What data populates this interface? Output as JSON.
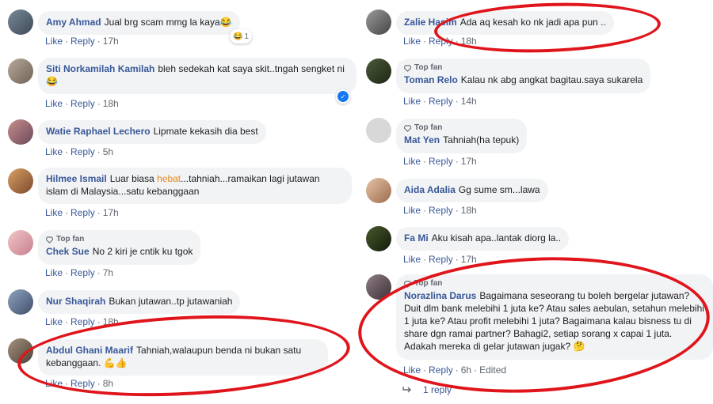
{
  "actions": {
    "like": "Like",
    "reply": "Reply",
    "sep": "·",
    "edited": "Edited"
  },
  "top_fan_label": "Top fan",
  "left": [
    {
      "name": "Amy Ahmad",
      "text": "Jual brg scam mmg la kaya",
      "emoji": "😂",
      "time": "17h",
      "reaction": {
        "icon": "😂",
        "count": "1"
      }
    },
    {
      "name": "Siti Norkamilah Kamilah",
      "text": "bleh sedekah kat saya skit..tngah sengket ni",
      "emoji": "😂",
      "time": "18h",
      "reaction": {
        "icon": "👍",
        "count": ""
      }
    },
    {
      "name": "Watie Raphael Lechero",
      "text": "Lipmate kekasih dia best",
      "time": "5h"
    },
    {
      "name": "Hilmee Ismail",
      "text_before": "Luar biasa ",
      "text_highlight": "hebat",
      "text_after": "...tahniah...ramaikan lagi jutawan islam di Malaysia...satu kebanggaan",
      "time": "17h"
    },
    {
      "name": "Chek Sue",
      "text": "No 2 kiri je cntik ku tgok",
      "time": "7h",
      "top_fan": true
    },
    {
      "name": "Nur Shaqirah",
      "text": "Bukan jutawan..tp jutawaniah",
      "time": "18h"
    },
    {
      "name": "Abdul Ghani Maarif",
      "text": "Tahniah,walaupun benda ni bukan satu kebanggaan.",
      "emoji": "💪👍",
      "time": "8h"
    }
  ],
  "right": [
    {
      "name": "Zalie Hasim",
      "text": "Ada aq kesah ko nk jadi apa pun ..",
      "time": "18h"
    },
    {
      "name": "Toman Relo",
      "text": "Kalau nk abg angkat bagitau.saya sukarela",
      "time": "14h",
      "top_fan": true
    },
    {
      "name": "Mat Yen",
      "text": "Tahniah(ha tepuk)",
      "time": "17h",
      "top_fan": true
    },
    {
      "name": "Aida Adalia",
      "text": "Gg sume sm...lawa",
      "time": "18h"
    },
    {
      "name": "Fa Mi",
      "text": "Aku kisah apa..lantak diorg la..",
      "time": "17h"
    },
    {
      "name": "Norazlina Darus",
      "text": "Bagaimana seseorang tu boleh bergelar jutawan? Duit dlm bank melebihi 1 juta ke? Atau sales aebulan, setahun melebihi 1 juta ke? Atau profit melebihi 1 juta? Bagaimana kalau bisness tu di share dgn ramai partner? Bahagi2, setiap sorang x capai 1 juta. Adakah mereka di gelar jutawan jugak?",
      "emoji": "🤔",
      "time": "6h",
      "top_fan": true,
      "edited": true
    }
  ],
  "replies_link": "1 reply",
  "colors": {
    "name": "#385898",
    "bubble": "#f2f3f5",
    "meta": "#606770",
    "ring": "#e0151b",
    "highlight": "#e8871e"
  }
}
